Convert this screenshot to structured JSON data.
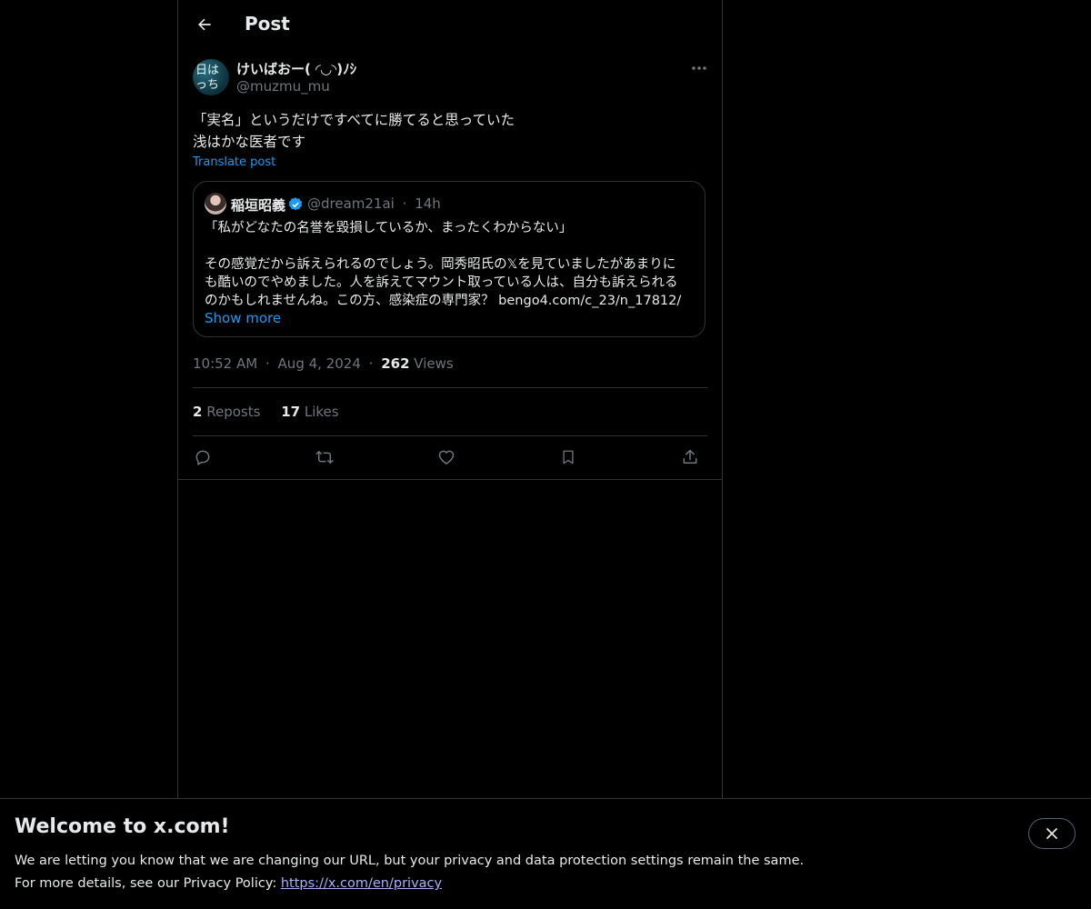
{
  "header": {
    "title": "Post"
  },
  "author": {
    "display_name": "けいばおー( ◜◡◝)ﾉｼ",
    "handle": "@muzmu_mu",
    "avatar_text": [
      "日は",
      "っち"
    ]
  },
  "post": {
    "lines": [
      "「実名」というだけですべてに勝てると思っていた",
      "浅はかな医者です"
    ],
    "translate_label": "Translate post"
  },
  "quote": {
    "name": "稲垣昭義",
    "handle": "@dream21ai",
    "separator": "·",
    "time": "14h",
    "first_line": "「私がどなたの名誉を毀損しているか、まったくわからない」",
    "body_lines": [
      "その感覚だから訴えられるのでしょう。岡秀昭氏の𝕏を見ていましたがあまりに",
      "も酷いのでやめました。人を訴えてマウント取っている人は、自分も訴えられる",
      "のかもしれませんね。この方、感染症の専門家？ bengo4.com/c_23/n_17812/"
    ],
    "show_more": "Show more"
  },
  "meta": {
    "time": "10:52 AM",
    "dot": "·",
    "date": "Aug 4, 2024",
    "views_count": "262",
    "views_label": "Views"
  },
  "stats": {
    "reposts_count": "2",
    "reposts_label": "Reposts",
    "likes_count": "17",
    "likes_label": "Likes"
  },
  "banner": {
    "title": "Welcome to x.com!",
    "line1": "We are letting you know that we are changing our URL, but your privacy and data protection settings remain the same.",
    "line2_prefix": "For more details, see our Privacy Policy: ",
    "link": "https://x.com/en/privacy"
  },
  "colors": {
    "background": "#000000",
    "text": "#e7e9ea",
    "muted": "#71767b",
    "accent": "#1d9bf0",
    "border": "#2f3336"
  },
  "icons": [
    "back-arrow-icon",
    "more-icon",
    "verified-icon",
    "reply-icon",
    "repost-icon",
    "like-icon",
    "bookmark-icon",
    "share-icon",
    "close-icon"
  ]
}
